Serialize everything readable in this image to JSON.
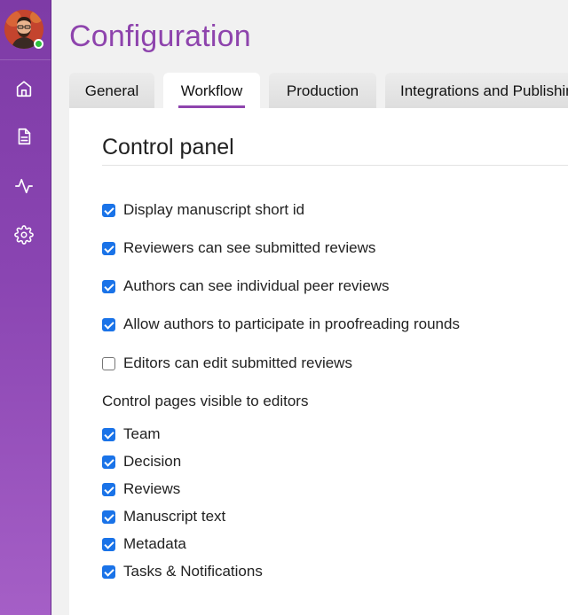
{
  "sidebar": {
    "avatar_icon": "user-avatar",
    "status": "online",
    "items": [
      {
        "icon": "home-icon"
      },
      {
        "icon": "document-icon"
      },
      {
        "icon": "activity-icon"
      },
      {
        "icon": "gear-icon"
      }
    ]
  },
  "page": {
    "title": "Configuration"
  },
  "tabs": [
    {
      "label": "General",
      "active": false
    },
    {
      "label": "Workflow",
      "active": true
    },
    {
      "label": "Production",
      "active": false
    },
    {
      "label": "Integrations and Publishing",
      "active": false
    }
  ],
  "panel": {
    "heading": "Control panel",
    "options": [
      {
        "label": "Display manuscript short id",
        "checked": true
      },
      {
        "label": "Reviewers can see submitted reviews",
        "checked": true
      },
      {
        "label": "Authors can see individual peer reviews",
        "checked": true
      },
      {
        "label": "Allow authors to participate in proofreading rounds",
        "checked": true
      },
      {
        "label": "Editors can edit submitted reviews",
        "checked": false
      }
    ],
    "pages_label": "Control pages visible to editors",
    "pages": [
      {
        "label": "Team",
        "checked": true
      },
      {
        "label": "Decision",
        "checked": true
      },
      {
        "label": "Reviews",
        "checked": true
      },
      {
        "label": "Manuscript text",
        "checked": true
      },
      {
        "label": "Metadata",
        "checked": true
      },
      {
        "label": "Tasks & Notifications",
        "checked": true
      }
    ]
  },
  "colors": {
    "brand": "#8e44ad",
    "checkbox": "#1a73e8",
    "status_online": "#2dbf3d"
  }
}
